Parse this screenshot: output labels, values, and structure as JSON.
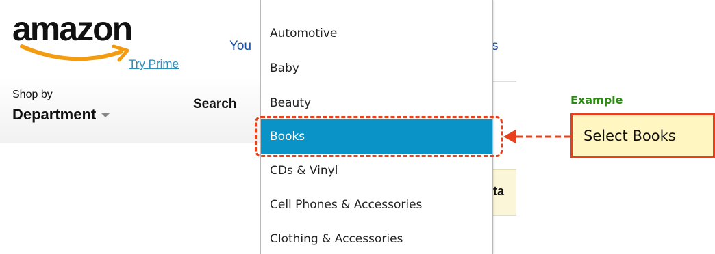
{
  "header": {
    "logo_text": "amazon",
    "try_prime": "Try Prime",
    "your_link": "You",
    "hidden_tail": "s"
  },
  "nav": {
    "shop_by": "Shop by",
    "department": "Department",
    "search_label": "Search"
  },
  "dropdown": {
    "items": [
      {
        "label": "Automotive",
        "selected": false
      },
      {
        "label": "Baby",
        "selected": false
      },
      {
        "label": "Beauty",
        "selected": false
      },
      {
        "label": "Books",
        "selected": true
      },
      {
        "label": "CDs & Vinyl",
        "selected": false
      },
      {
        "label": "Cell Phones & Accessories",
        "selected": false
      },
      {
        "label": "Clothing & Accessories",
        "selected": false
      }
    ],
    "selected_color": "#0a93c6"
  },
  "content_peek": {
    "text": "ta"
  },
  "annotation": {
    "example_label": "Example",
    "callout_text": "Select Books",
    "accent_color": "#e8401c",
    "callout_bg": "#fff6c2",
    "example_color": "#2a8a12"
  },
  "icons": {
    "logo_smile": "amazon-smile-arrow-icon",
    "caret": "caret-down-icon",
    "arrow": "left-arrow-icon"
  }
}
